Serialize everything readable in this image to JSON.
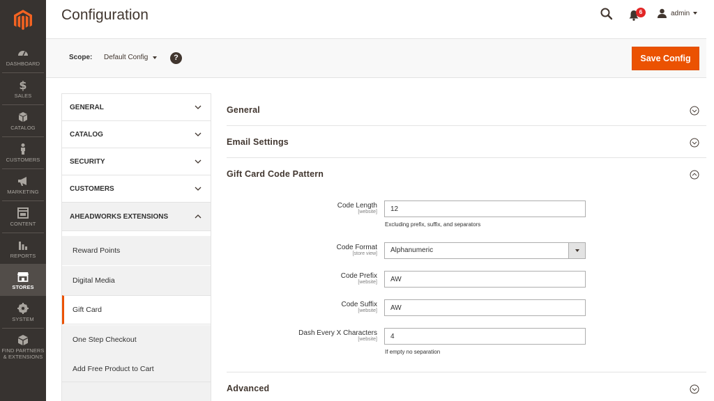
{
  "sidebar": {
    "logo": "magento-logo",
    "items": [
      {
        "label": "DASHBOARD",
        "icon": "dashboard-icon"
      },
      {
        "label": "SALES",
        "icon": "dollar-icon"
      },
      {
        "label": "CATALOG",
        "icon": "cube-icon"
      },
      {
        "label": "CUSTOMERS",
        "icon": "person-icon"
      },
      {
        "label": "MARKETING",
        "icon": "megaphone-icon"
      },
      {
        "label": "CONTENT",
        "icon": "layout-icon"
      },
      {
        "label": "REPORTS",
        "icon": "bar-chart-icon"
      },
      {
        "label": "STORES",
        "icon": "storefront-icon",
        "active": true
      },
      {
        "label": "SYSTEM",
        "icon": "gear-icon"
      },
      {
        "label": "FIND PARTNERS & EXTENSIONS",
        "icon": "box-icon"
      }
    ]
  },
  "header": {
    "title": "Configuration",
    "notifications_count": "6",
    "user": "admin"
  },
  "scope": {
    "label": "Scope:",
    "value": "Default Config",
    "help": "?",
    "save_label": "Save Config"
  },
  "config_nav": {
    "tabs": [
      "GENERAL",
      "CATALOG",
      "SECURITY",
      "CUSTOMERS",
      "AHEADWORKS EXTENSIONS"
    ],
    "sub_items": [
      "Reward Points",
      "Digital Media",
      "Gift Card",
      "One Step Checkout",
      "Add Free Product to Cart"
    ],
    "active_sub_item": "Gift Card"
  },
  "sections": {
    "general": "General",
    "email": "Email Settings",
    "pattern": "Gift Card Code Pattern",
    "advanced": "Advanced"
  },
  "fields": {
    "code_length": {
      "label": "Code Length",
      "scope": "[website]",
      "value": "12",
      "note": "Excluding prefix, suffix, and separators"
    },
    "code_format": {
      "label": "Code Format",
      "scope": "[store view]",
      "value": "Alphanumeric"
    },
    "code_prefix": {
      "label": "Code Prefix",
      "scope": "[website]",
      "value": "AW"
    },
    "code_suffix": {
      "label": "Code Suffix",
      "scope": "[website]",
      "value": "AW"
    },
    "dash_every": {
      "label": "Dash Every X Characters",
      "scope": "[website]",
      "value": "4",
      "note": "If empty no separation"
    }
  },
  "colors": {
    "accent": "#eb5202",
    "menu_bg": "#373330",
    "badge": "#e22626"
  }
}
